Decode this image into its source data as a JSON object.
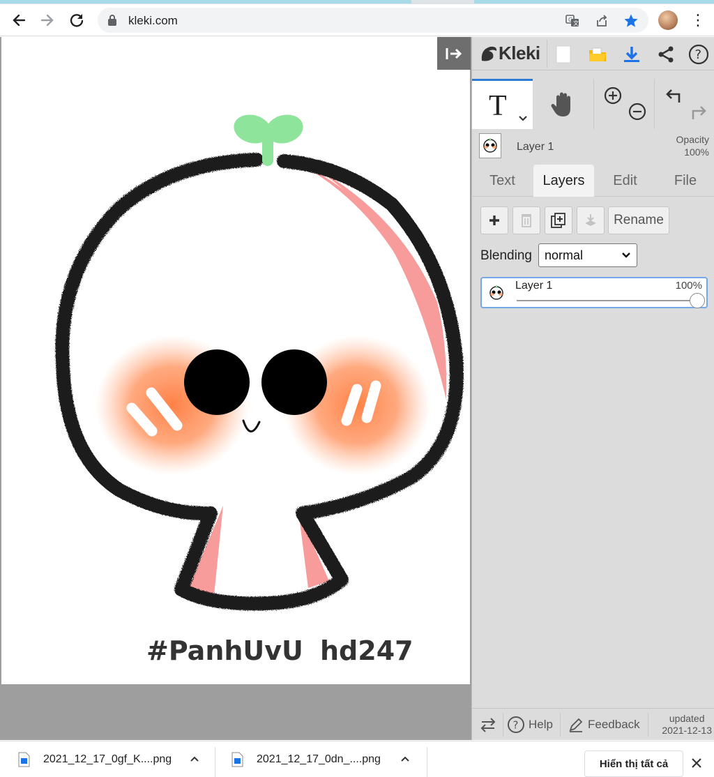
{
  "browser": {
    "url": "kleki.com",
    "icons": [
      "back-arrow-icon",
      "forward-arrow-icon",
      "reload-icon",
      "lock-icon",
      "translate-icon",
      "share-icon",
      "bookmark-star-icon",
      "profile-avatar",
      "kebab-menu-icon"
    ]
  },
  "app": {
    "logo_text": "Kleki",
    "header_icons": [
      "new-image-icon",
      "open-folder-icon",
      "download-icon",
      "share-icon",
      "help-icon"
    ],
    "tools": [
      "text-tool",
      "hand-tool",
      "zoom-in-icon",
      "zoom-out-icon",
      "undo-icon",
      "redo-icon"
    ],
    "text_tool_glyph": "T",
    "current_layer": {
      "name": "Layer 1",
      "opacity_label": "Opacity",
      "opacity_value": "100%"
    },
    "tabs": [
      {
        "label": "Text",
        "active": false
      },
      {
        "label": "Layers",
        "active": true
      },
      {
        "label": "Edit",
        "active": false
      },
      {
        "label": "File",
        "active": false
      }
    ],
    "layer_buttons": {
      "icons": [
        "add-layer-icon",
        "delete-layer-icon",
        "duplicate-layer-icon",
        "merge-down-icon"
      ],
      "rename_label": "Rename"
    },
    "blending": {
      "label": "Blending",
      "value": "normal"
    },
    "layers": [
      {
        "name": "Layer 1",
        "opacity": "100%",
        "opacity_fraction": 1.0
      }
    ],
    "footer": {
      "help_label": "Help",
      "feedback_label": "Feedback",
      "updated_label": "updated",
      "updated_date": "2021-12-13"
    },
    "colors": {
      "accent": "#2a7ad6",
      "folder_yellow": "#f5b800",
      "download_blue": "#1a73e8",
      "canvas_bg": "#9e9e9e",
      "panel_bg": "#dcdcdc"
    }
  },
  "artwork": {
    "caption_left": "#PanhUvU",
    "caption_right": "hd247",
    "colors": {
      "outline": "#1c1c1c",
      "sprout": "#8ee49a",
      "shade": "#f79b9b",
      "blush": "#ff7a3c",
      "eyes": "#000000"
    }
  },
  "downloads_bar": {
    "items": [
      {
        "filename": "2021_12_17_0gf_K....png"
      },
      {
        "filename": "2021_12_17_0dn_....png"
      }
    ],
    "show_all_label": "Hiển thị tất cả"
  }
}
